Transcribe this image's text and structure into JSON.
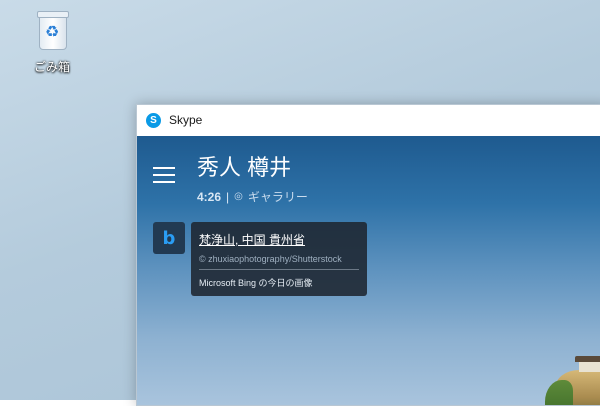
{
  "desktop": {
    "recycle_bin": {
      "label": "ごみ箱",
      "icon": "recycle-bin-icon"
    }
  },
  "window": {
    "title": "Skype",
    "app_icon": "skype-logo-icon"
  },
  "profile": {
    "name": "秀人 樽井",
    "status_time": "4:26",
    "status_separator": "|",
    "gallery_icon": "gallery-icon",
    "gallery_label": "ギャラリー"
  },
  "menu": {
    "icon": "hamburger-menu-icon"
  },
  "bing_card": {
    "icon": "bing-icon",
    "title": "梵浄山, 中国 貴州省",
    "credit": "© zhuxiaophotography/Shutterstock",
    "subtitle": "Microsoft Bing の今日の画像"
  },
  "colors": {
    "skype_blue": "#0a9ae6",
    "card_bg": "#1e2630",
    "bing_blue": "#2a9df4"
  }
}
